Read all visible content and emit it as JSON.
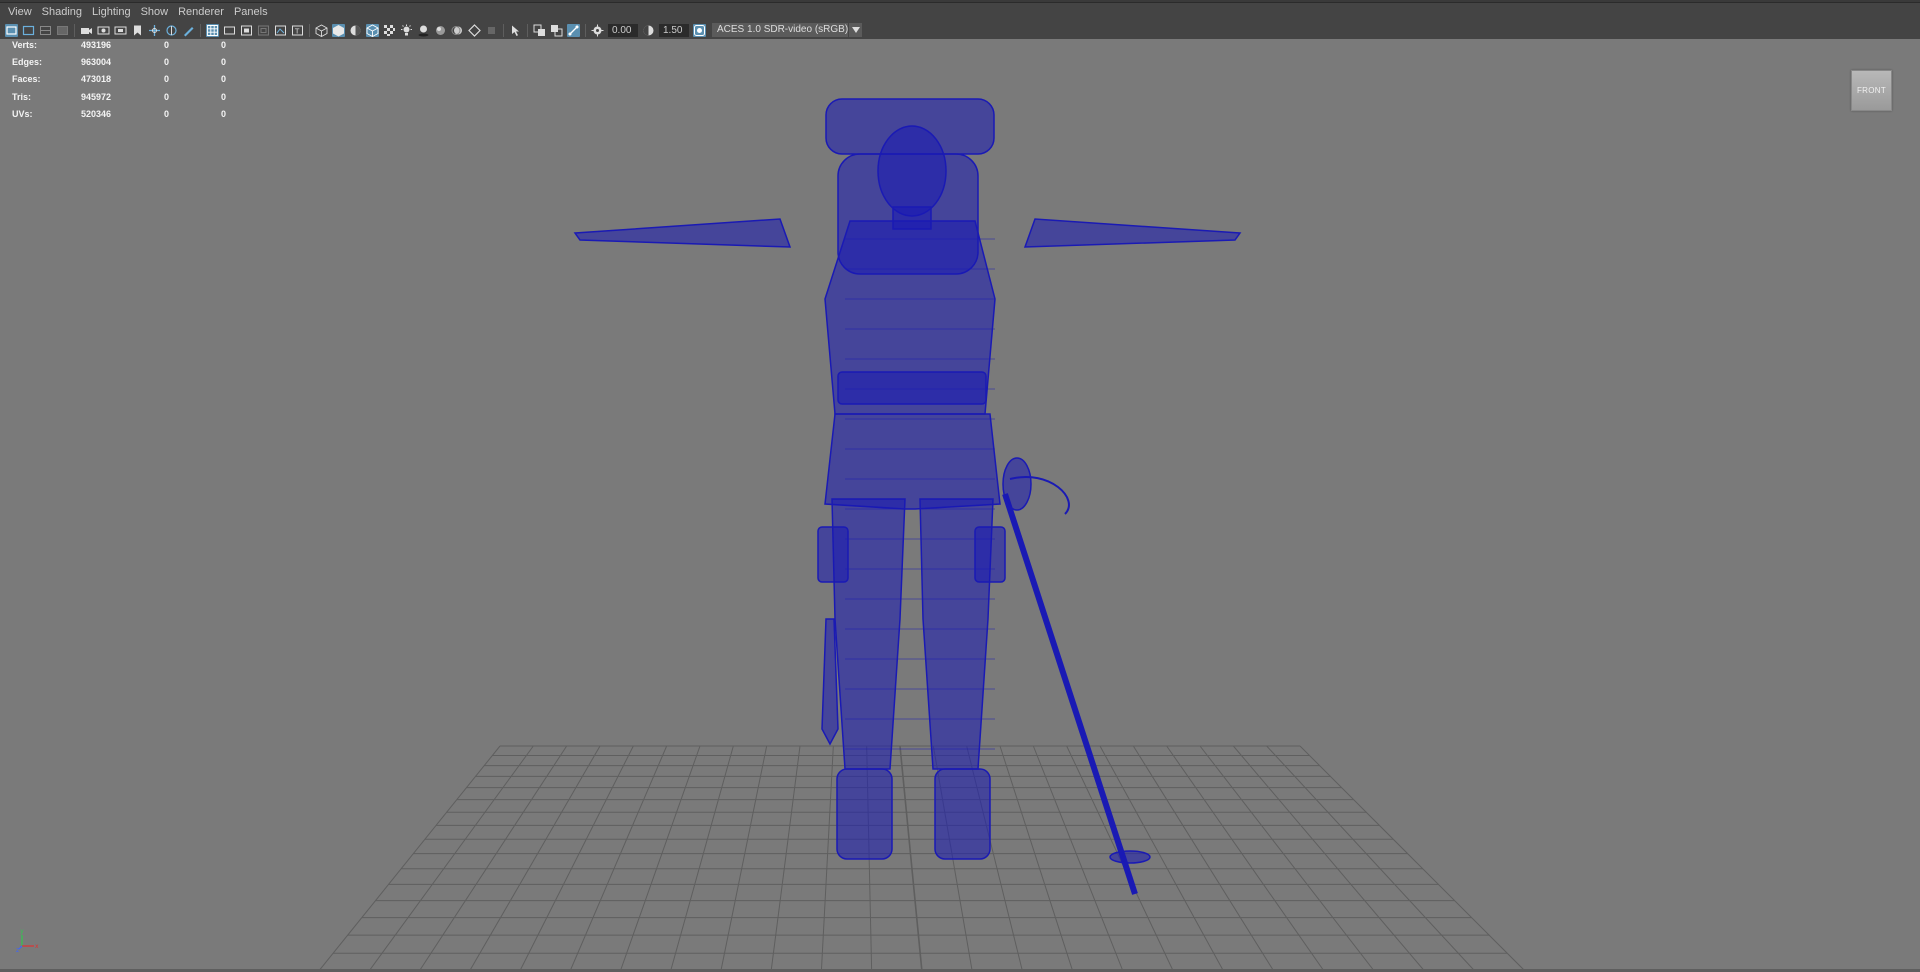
{
  "menubar": {
    "items": [
      "View",
      "Shading",
      "Lighting",
      "Show",
      "Renderer",
      "Panels"
    ]
  },
  "toolbar": {
    "exposure_value": "0.00",
    "gamma_value": "1.50",
    "color_space": "ACES 1.0 SDR-video (sRGB)"
  },
  "hud": {
    "rows": [
      {
        "label": "Verts:",
        "v1": "493196",
        "v2": "0",
        "v3": "0"
      },
      {
        "label": "Edges:",
        "v1": "963004",
        "v2": "0",
        "v3": "0"
      },
      {
        "label": "Faces:",
        "v1": "473018",
        "v2": "0",
        "v3": "0"
      },
      {
        "label": "Tris:",
        "v1": "945972",
        "v2": "0",
        "v3": "0"
      },
      {
        "label": "UVs:",
        "v1": "520346",
        "v2": "0",
        "v3": "0"
      }
    ]
  },
  "viewcube": {
    "label": "FRONT"
  },
  "colors": {
    "viewport_bg": "#7a7a7a",
    "wireframe": "#1a1ab4",
    "grid": "#5f5f5f",
    "ui_bg": "#444444",
    "active_icon": "#5a8fb0",
    "axis_y": "#32c850",
    "axis_x": "#e03030",
    "axis_z": "#3c64ff"
  },
  "axis_labels": {
    "y": "y",
    "x": "x",
    "z": "z"
  }
}
